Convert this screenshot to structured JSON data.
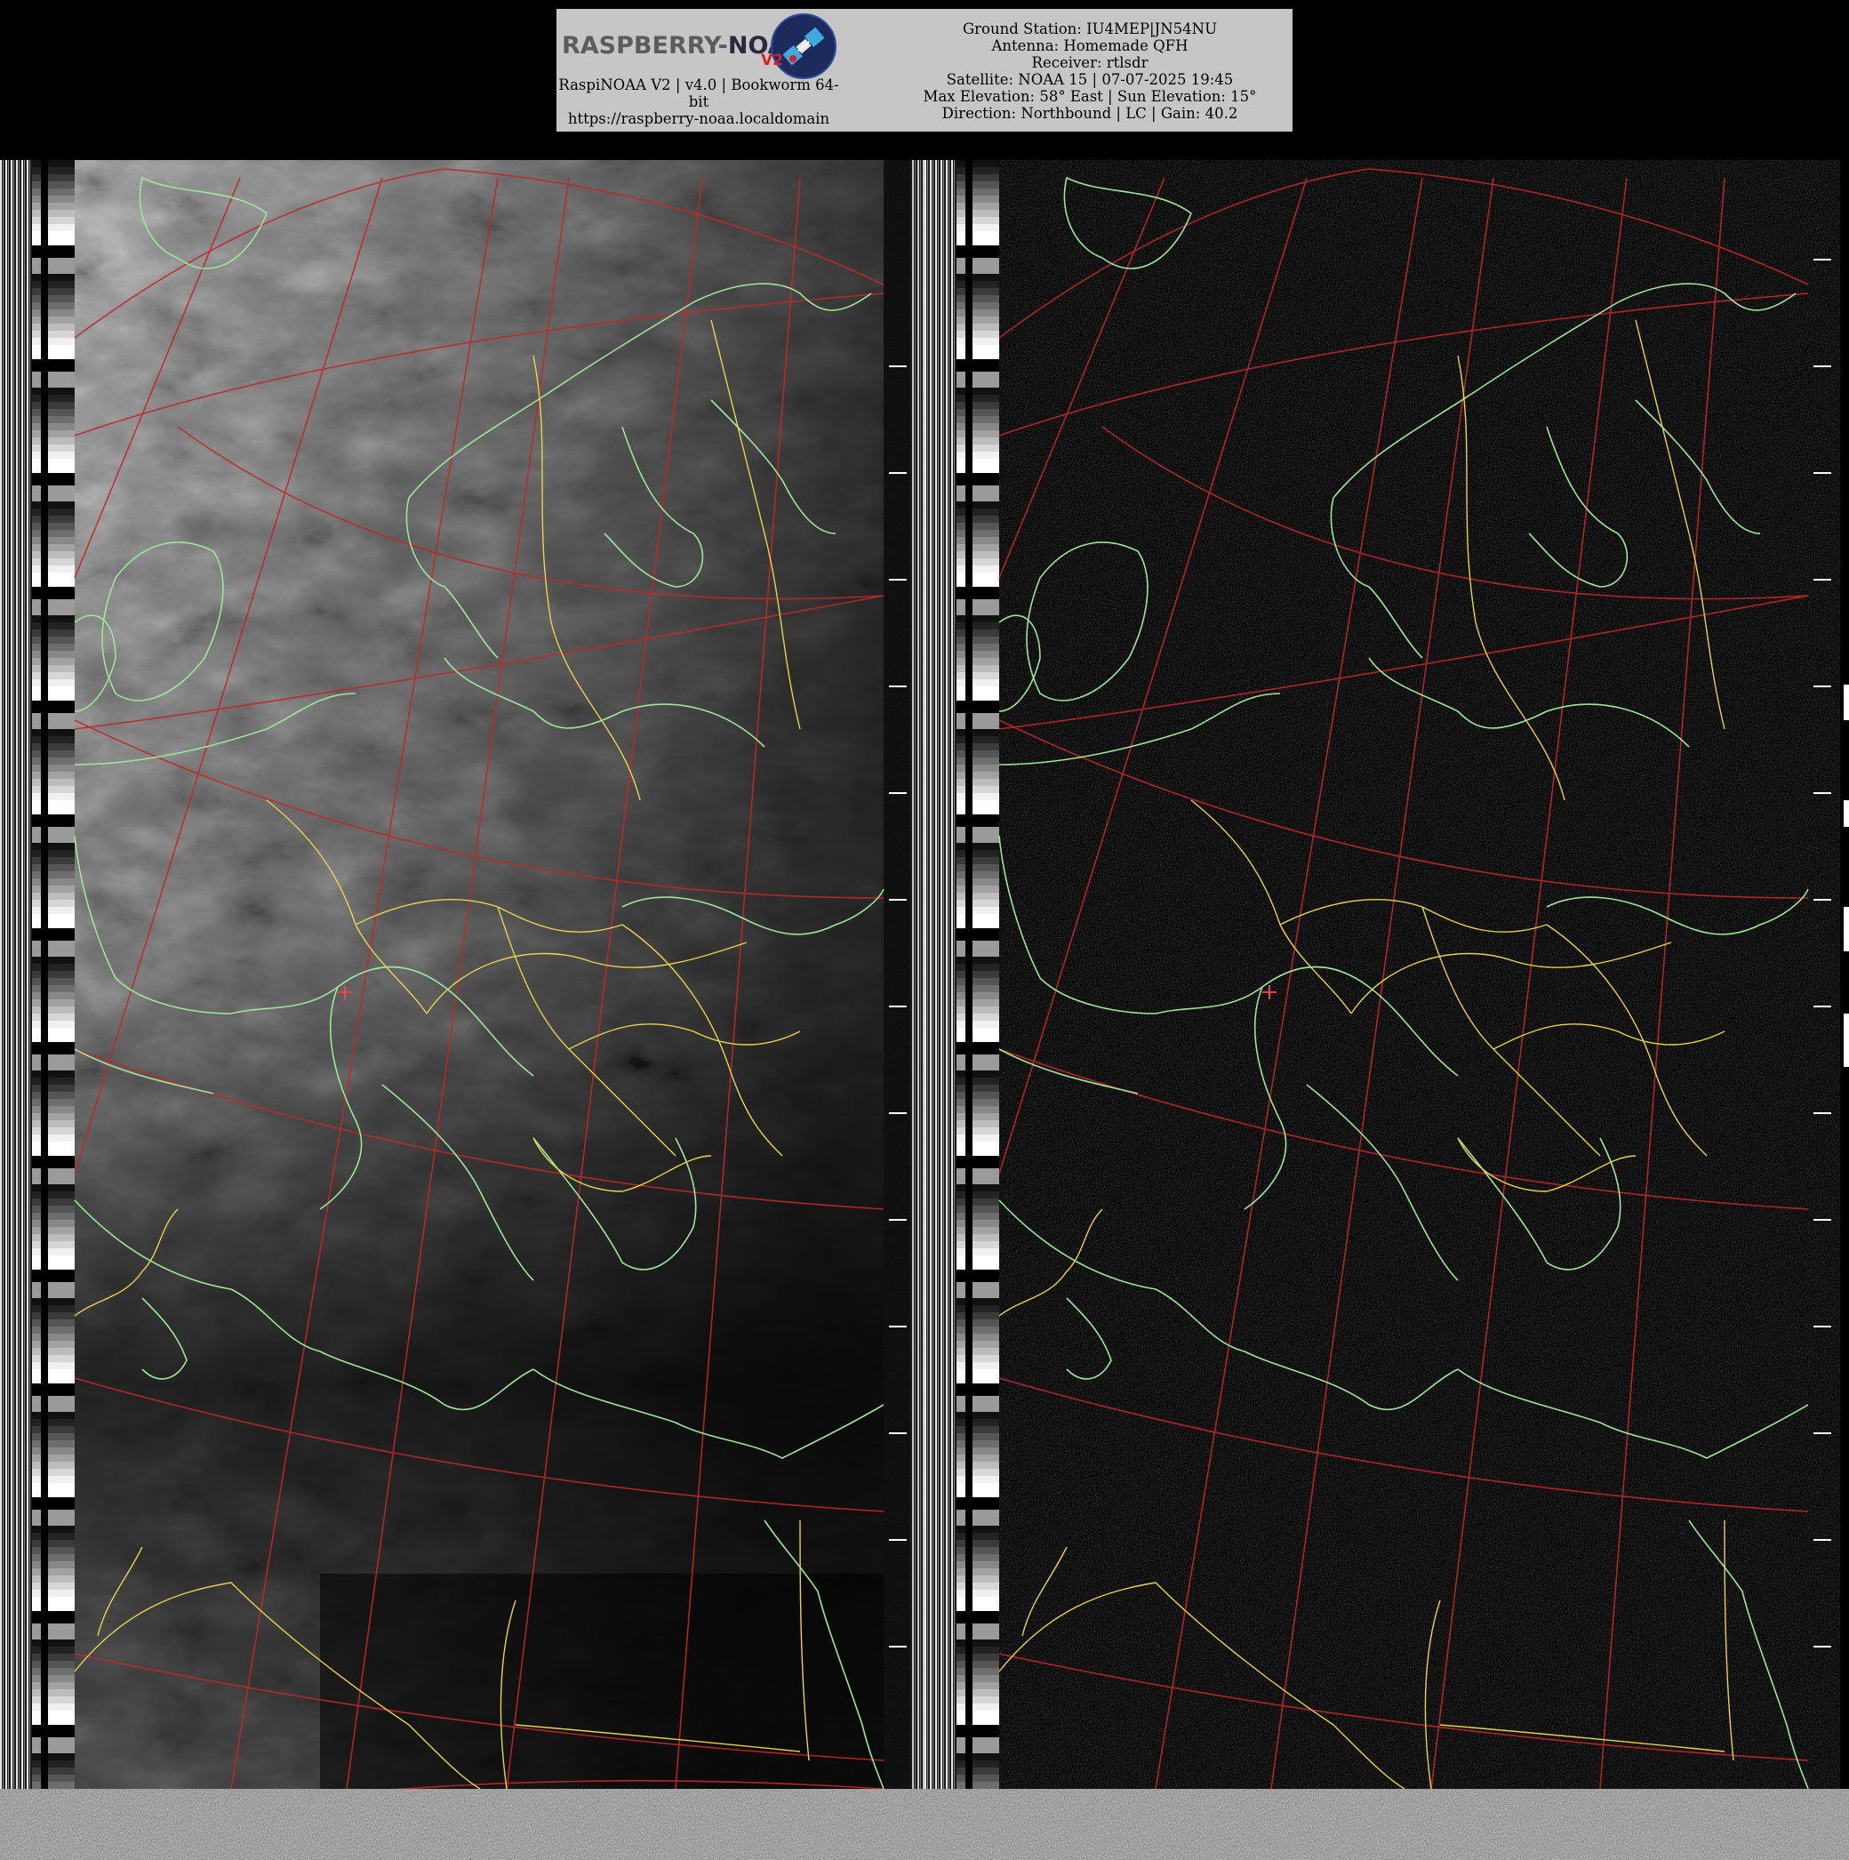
{
  "header": {
    "logo": {
      "word_left": "RASPBERRY-",
      "word_right": "NOAA",
      "version_mark": "V2",
      "logo_badge_icon": "satellite-icon"
    },
    "left_caption": {
      "line1": "RaspiNOAA V2 | v4.0 | Bookworm 64-",
      "line2": "bit",
      "line3": "https://raspberry-noaa.localdomain"
    },
    "pass_info": {
      "ground_station": "Ground Station: IU4MEP|JN54NU",
      "antenna": "Antenna: Homemade QFH",
      "receiver": "Receiver: rtlsdr",
      "satellite": "Satellite: NOAA 15 | 07-07-2025 19:45",
      "elevation": "Max Elevation: 58° East | Sun Elevation: 15°",
      "direction": "Direction: Northbound | LC | Gain: 40.2"
    }
  },
  "image": {
    "channel_a": "visible-channel",
    "channel_b": "infrared-channel",
    "overlay_colors": {
      "graticule": "#c0282a",
      "coastline": "#9ee59a",
      "borders": "#e6d44a",
      "station_marker": "#ff4040"
    },
    "background": "#000000",
    "header_bg": "#c6c6c6"
  }
}
